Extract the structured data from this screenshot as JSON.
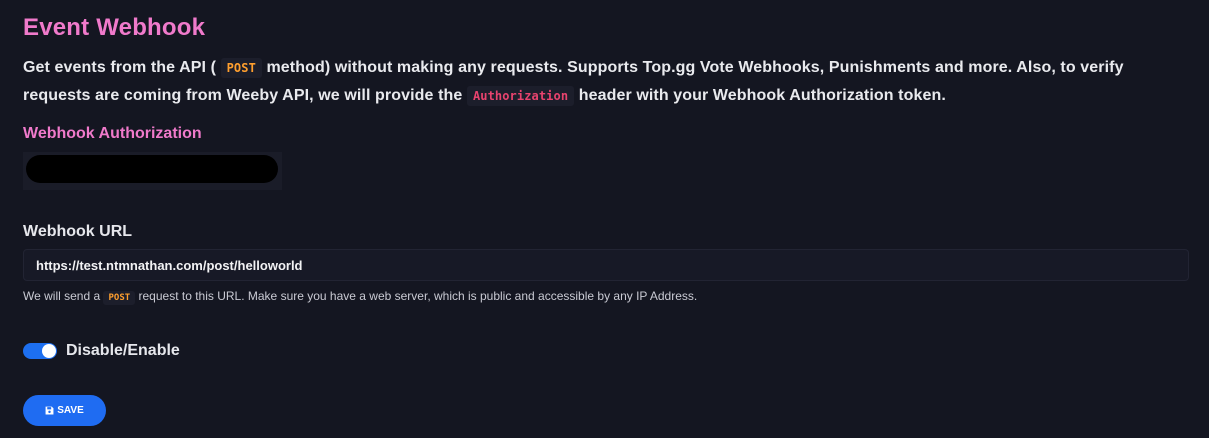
{
  "header": {
    "title": "Event Webhook"
  },
  "description": {
    "part1": "Get events from the API ( ",
    "method_code": "POST",
    "part2": " method) without making any requests. Supports Top.gg Vote Webhooks, Punishments and more. Also, to verify requests are coming from Weeby API, we will provide the ",
    "header_code": "Authorization",
    "part3": " header with your Webhook Authorization token."
  },
  "authorization": {
    "label": "Webhook Authorization"
  },
  "webhook_url": {
    "label": "Webhook URL",
    "value": "https://test.ntmnathan.com/post/helloworld",
    "help_part1": "We will send a ",
    "help_code": "POST",
    "help_part2": " request to this URL. Make sure you have a web server, which is public and accessible by any IP Address."
  },
  "toggle": {
    "label": "Disable/Enable",
    "enabled": true
  },
  "save_button": {
    "label": "SAVE",
    "icon": "floppy-disk-icon"
  },
  "colors": {
    "background": "#141621",
    "heading_pink": "#f07acb",
    "accent_blue": "#1f6cf2",
    "code_orange": "#ff9f2e",
    "code_red": "#e8436e"
  }
}
